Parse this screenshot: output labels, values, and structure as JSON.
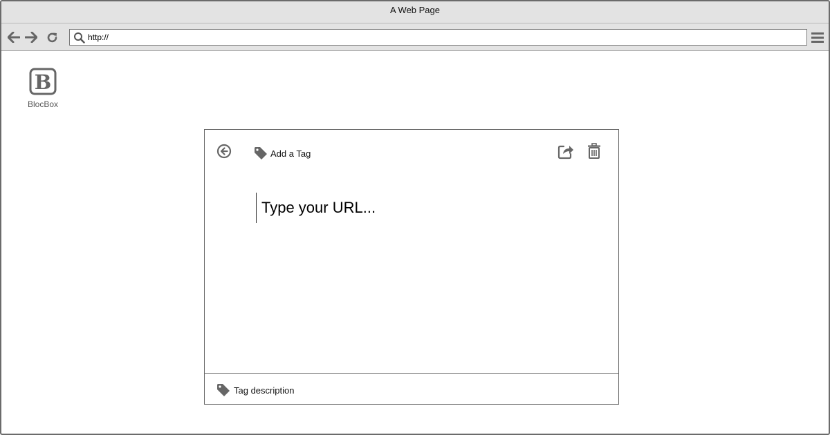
{
  "browser": {
    "window_title": "A Web Page",
    "address_value": "http://",
    "nav_icons": [
      "arrow-left-icon",
      "arrow-right-icon",
      "reload-icon",
      "search-icon",
      "hamburger-menu-icon"
    ]
  },
  "app": {
    "brand_name": "BlocBox",
    "logo_letter": "B"
  },
  "card": {
    "add_tag_label": "Add a Tag",
    "url_placeholder": "Type your URL...",
    "footer_label": "Tag description",
    "icons": [
      "back-circle-icon",
      "tag-icon",
      "share-icon",
      "trash-icon"
    ]
  },
  "colors": {
    "chrome_bg": "#e3e3e3",
    "icon_gray": "#666666",
    "border": "#666666"
  }
}
